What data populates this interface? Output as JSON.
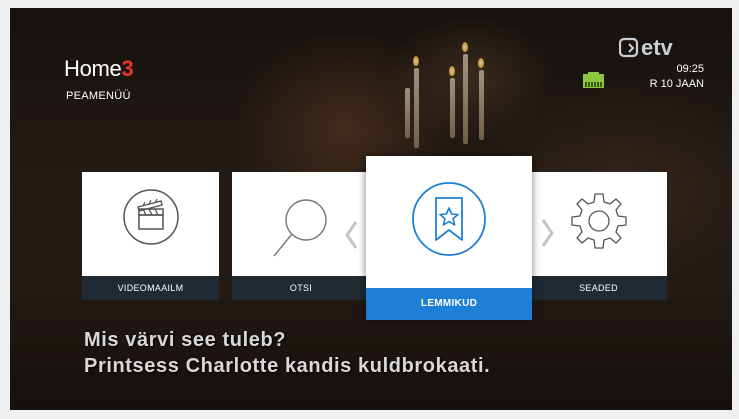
{
  "header": {
    "logo_text": "Home",
    "logo_accent": "3",
    "subtitle": "PEAMENÜÜ"
  },
  "status": {
    "brand": "etv",
    "time": "09:25",
    "date": "R 10 JAAN"
  },
  "menu": {
    "items": [
      {
        "label": "VIDEOMAAILM",
        "icon": "clapperboard-icon",
        "selected": false
      },
      {
        "label": "OTSI",
        "icon": "search-icon",
        "selected": false
      },
      {
        "label": "LEMMIKUD",
        "icon": "bookmark-star-icon",
        "selected": true
      },
      {
        "label": "SEADED",
        "icon": "gear-icon",
        "selected": false
      }
    ]
  },
  "subtitles": {
    "line1": "Mis värvi see tuleb?",
    "line2": "Printsess Charlotte kandis kuldbrokaati."
  },
  "colors": {
    "accent_red": "#e63323",
    "selected_blue": "#1e7fd6",
    "label_bar": "#1f2a33",
    "network_green": "#8ec63f"
  }
}
